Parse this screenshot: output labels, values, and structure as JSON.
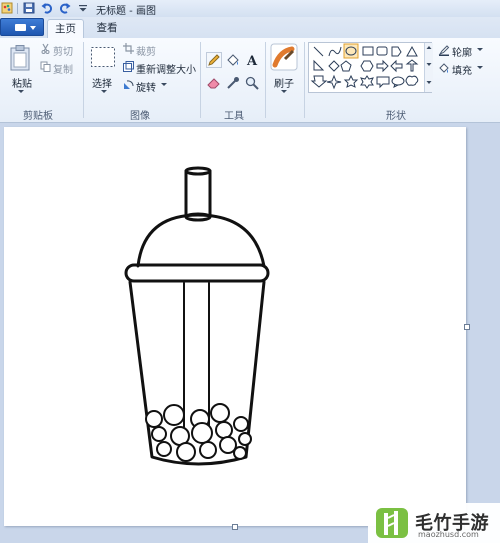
{
  "window": {
    "title": "无标题 - 画图"
  },
  "ribbon": {
    "tabs": [
      {
        "label": "主页"
      },
      {
        "label": "查看"
      }
    ],
    "clipboard": {
      "group_label": "剪贴板",
      "paste": "粘贴",
      "cut": "剪切",
      "copy": "复制"
    },
    "image": {
      "group_label": "图像",
      "select": "选择",
      "crop": "裁剪",
      "resize": "重新调整大小",
      "rotate": "旋转"
    },
    "tools": {
      "group_label": "工具"
    },
    "brushes": {
      "label": "刷子"
    },
    "shapes": {
      "group_label": "形状",
      "outline": "轮廓",
      "fill": "填充"
    }
  },
  "watermark": {
    "brand": "毛竹手游",
    "domain": "maozhusd.com"
  },
  "colors": {
    "ribbon_bg": "#f3f7fc",
    "canvas_bg": "#c9d6ea",
    "paper": "#ffffff",
    "file_button": "#2a63c1",
    "accent_icon": "#e07a2e"
  }
}
